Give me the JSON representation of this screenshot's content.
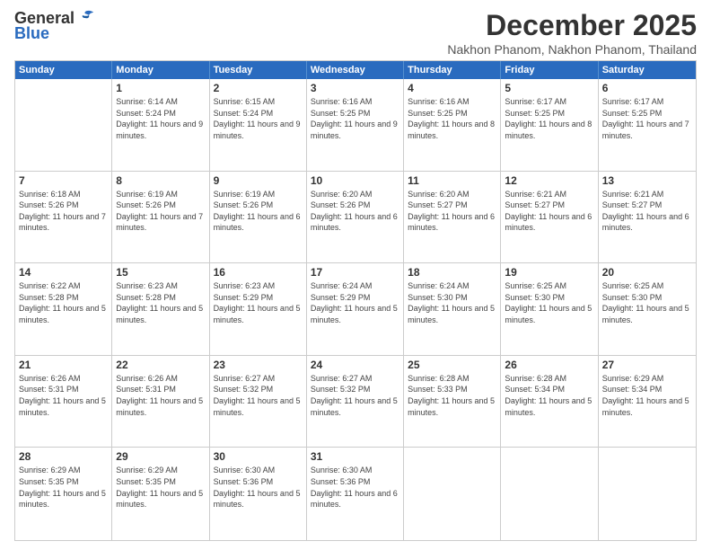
{
  "header": {
    "logo_general": "General",
    "logo_blue": "Blue",
    "month_title": "December 2025",
    "location": "Nakhon Phanom, Nakhon Phanom, Thailand"
  },
  "calendar": {
    "days_of_week": [
      "Sunday",
      "Monday",
      "Tuesday",
      "Wednesday",
      "Thursday",
      "Friday",
      "Saturday"
    ],
    "weeks": [
      [
        {
          "day": "",
          "sunrise": "",
          "sunset": "",
          "daylight": ""
        },
        {
          "day": "1",
          "sunrise": "Sunrise: 6:14 AM",
          "sunset": "Sunset: 5:24 PM",
          "daylight": "Daylight: 11 hours and 9 minutes."
        },
        {
          "day": "2",
          "sunrise": "Sunrise: 6:15 AM",
          "sunset": "Sunset: 5:24 PM",
          "daylight": "Daylight: 11 hours and 9 minutes."
        },
        {
          "day": "3",
          "sunrise": "Sunrise: 6:16 AM",
          "sunset": "Sunset: 5:25 PM",
          "daylight": "Daylight: 11 hours and 9 minutes."
        },
        {
          "day": "4",
          "sunrise": "Sunrise: 6:16 AM",
          "sunset": "Sunset: 5:25 PM",
          "daylight": "Daylight: 11 hours and 8 minutes."
        },
        {
          "day": "5",
          "sunrise": "Sunrise: 6:17 AM",
          "sunset": "Sunset: 5:25 PM",
          "daylight": "Daylight: 11 hours and 8 minutes."
        },
        {
          "day": "6",
          "sunrise": "Sunrise: 6:17 AM",
          "sunset": "Sunset: 5:25 PM",
          "daylight": "Daylight: 11 hours and 7 minutes."
        }
      ],
      [
        {
          "day": "7",
          "sunrise": "Sunrise: 6:18 AM",
          "sunset": "Sunset: 5:26 PM",
          "daylight": "Daylight: 11 hours and 7 minutes."
        },
        {
          "day": "8",
          "sunrise": "Sunrise: 6:19 AM",
          "sunset": "Sunset: 5:26 PM",
          "daylight": "Daylight: 11 hours and 7 minutes."
        },
        {
          "day": "9",
          "sunrise": "Sunrise: 6:19 AM",
          "sunset": "Sunset: 5:26 PM",
          "daylight": "Daylight: 11 hours and 6 minutes."
        },
        {
          "day": "10",
          "sunrise": "Sunrise: 6:20 AM",
          "sunset": "Sunset: 5:26 PM",
          "daylight": "Daylight: 11 hours and 6 minutes."
        },
        {
          "day": "11",
          "sunrise": "Sunrise: 6:20 AM",
          "sunset": "Sunset: 5:27 PM",
          "daylight": "Daylight: 11 hours and 6 minutes."
        },
        {
          "day": "12",
          "sunrise": "Sunrise: 6:21 AM",
          "sunset": "Sunset: 5:27 PM",
          "daylight": "Daylight: 11 hours and 6 minutes."
        },
        {
          "day": "13",
          "sunrise": "Sunrise: 6:21 AM",
          "sunset": "Sunset: 5:27 PM",
          "daylight": "Daylight: 11 hours and 6 minutes."
        }
      ],
      [
        {
          "day": "14",
          "sunrise": "Sunrise: 6:22 AM",
          "sunset": "Sunset: 5:28 PM",
          "daylight": "Daylight: 11 hours and 5 minutes."
        },
        {
          "day": "15",
          "sunrise": "Sunrise: 6:23 AM",
          "sunset": "Sunset: 5:28 PM",
          "daylight": "Daylight: 11 hours and 5 minutes."
        },
        {
          "day": "16",
          "sunrise": "Sunrise: 6:23 AM",
          "sunset": "Sunset: 5:29 PM",
          "daylight": "Daylight: 11 hours and 5 minutes."
        },
        {
          "day": "17",
          "sunrise": "Sunrise: 6:24 AM",
          "sunset": "Sunset: 5:29 PM",
          "daylight": "Daylight: 11 hours and 5 minutes."
        },
        {
          "day": "18",
          "sunrise": "Sunrise: 6:24 AM",
          "sunset": "Sunset: 5:30 PM",
          "daylight": "Daylight: 11 hours and 5 minutes."
        },
        {
          "day": "19",
          "sunrise": "Sunrise: 6:25 AM",
          "sunset": "Sunset: 5:30 PM",
          "daylight": "Daylight: 11 hours and 5 minutes."
        },
        {
          "day": "20",
          "sunrise": "Sunrise: 6:25 AM",
          "sunset": "Sunset: 5:30 PM",
          "daylight": "Daylight: 11 hours and 5 minutes."
        }
      ],
      [
        {
          "day": "21",
          "sunrise": "Sunrise: 6:26 AM",
          "sunset": "Sunset: 5:31 PM",
          "daylight": "Daylight: 11 hours and 5 minutes."
        },
        {
          "day": "22",
          "sunrise": "Sunrise: 6:26 AM",
          "sunset": "Sunset: 5:31 PM",
          "daylight": "Daylight: 11 hours and 5 minutes."
        },
        {
          "day": "23",
          "sunrise": "Sunrise: 6:27 AM",
          "sunset": "Sunset: 5:32 PM",
          "daylight": "Daylight: 11 hours and 5 minutes."
        },
        {
          "day": "24",
          "sunrise": "Sunrise: 6:27 AM",
          "sunset": "Sunset: 5:32 PM",
          "daylight": "Daylight: 11 hours and 5 minutes."
        },
        {
          "day": "25",
          "sunrise": "Sunrise: 6:28 AM",
          "sunset": "Sunset: 5:33 PM",
          "daylight": "Daylight: 11 hours and 5 minutes."
        },
        {
          "day": "26",
          "sunrise": "Sunrise: 6:28 AM",
          "sunset": "Sunset: 5:34 PM",
          "daylight": "Daylight: 11 hours and 5 minutes."
        },
        {
          "day": "27",
          "sunrise": "Sunrise: 6:29 AM",
          "sunset": "Sunset: 5:34 PM",
          "daylight": "Daylight: 11 hours and 5 minutes."
        }
      ],
      [
        {
          "day": "28",
          "sunrise": "Sunrise: 6:29 AM",
          "sunset": "Sunset: 5:35 PM",
          "daylight": "Daylight: 11 hours and 5 minutes."
        },
        {
          "day": "29",
          "sunrise": "Sunrise: 6:29 AM",
          "sunset": "Sunset: 5:35 PM",
          "daylight": "Daylight: 11 hours and 5 minutes."
        },
        {
          "day": "30",
          "sunrise": "Sunrise: 6:30 AM",
          "sunset": "Sunset: 5:36 PM",
          "daylight": "Daylight: 11 hours and 5 minutes."
        },
        {
          "day": "31",
          "sunrise": "Sunrise: 6:30 AM",
          "sunset": "Sunset: 5:36 PM",
          "daylight": "Daylight: 11 hours and 6 minutes."
        },
        {
          "day": "",
          "sunrise": "",
          "sunset": "",
          "daylight": ""
        },
        {
          "day": "",
          "sunrise": "",
          "sunset": "",
          "daylight": ""
        },
        {
          "day": "",
          "sunrise": "",
          "sunset": "",
          "daylight": ""
        }
      ]
    ]
  }
}
